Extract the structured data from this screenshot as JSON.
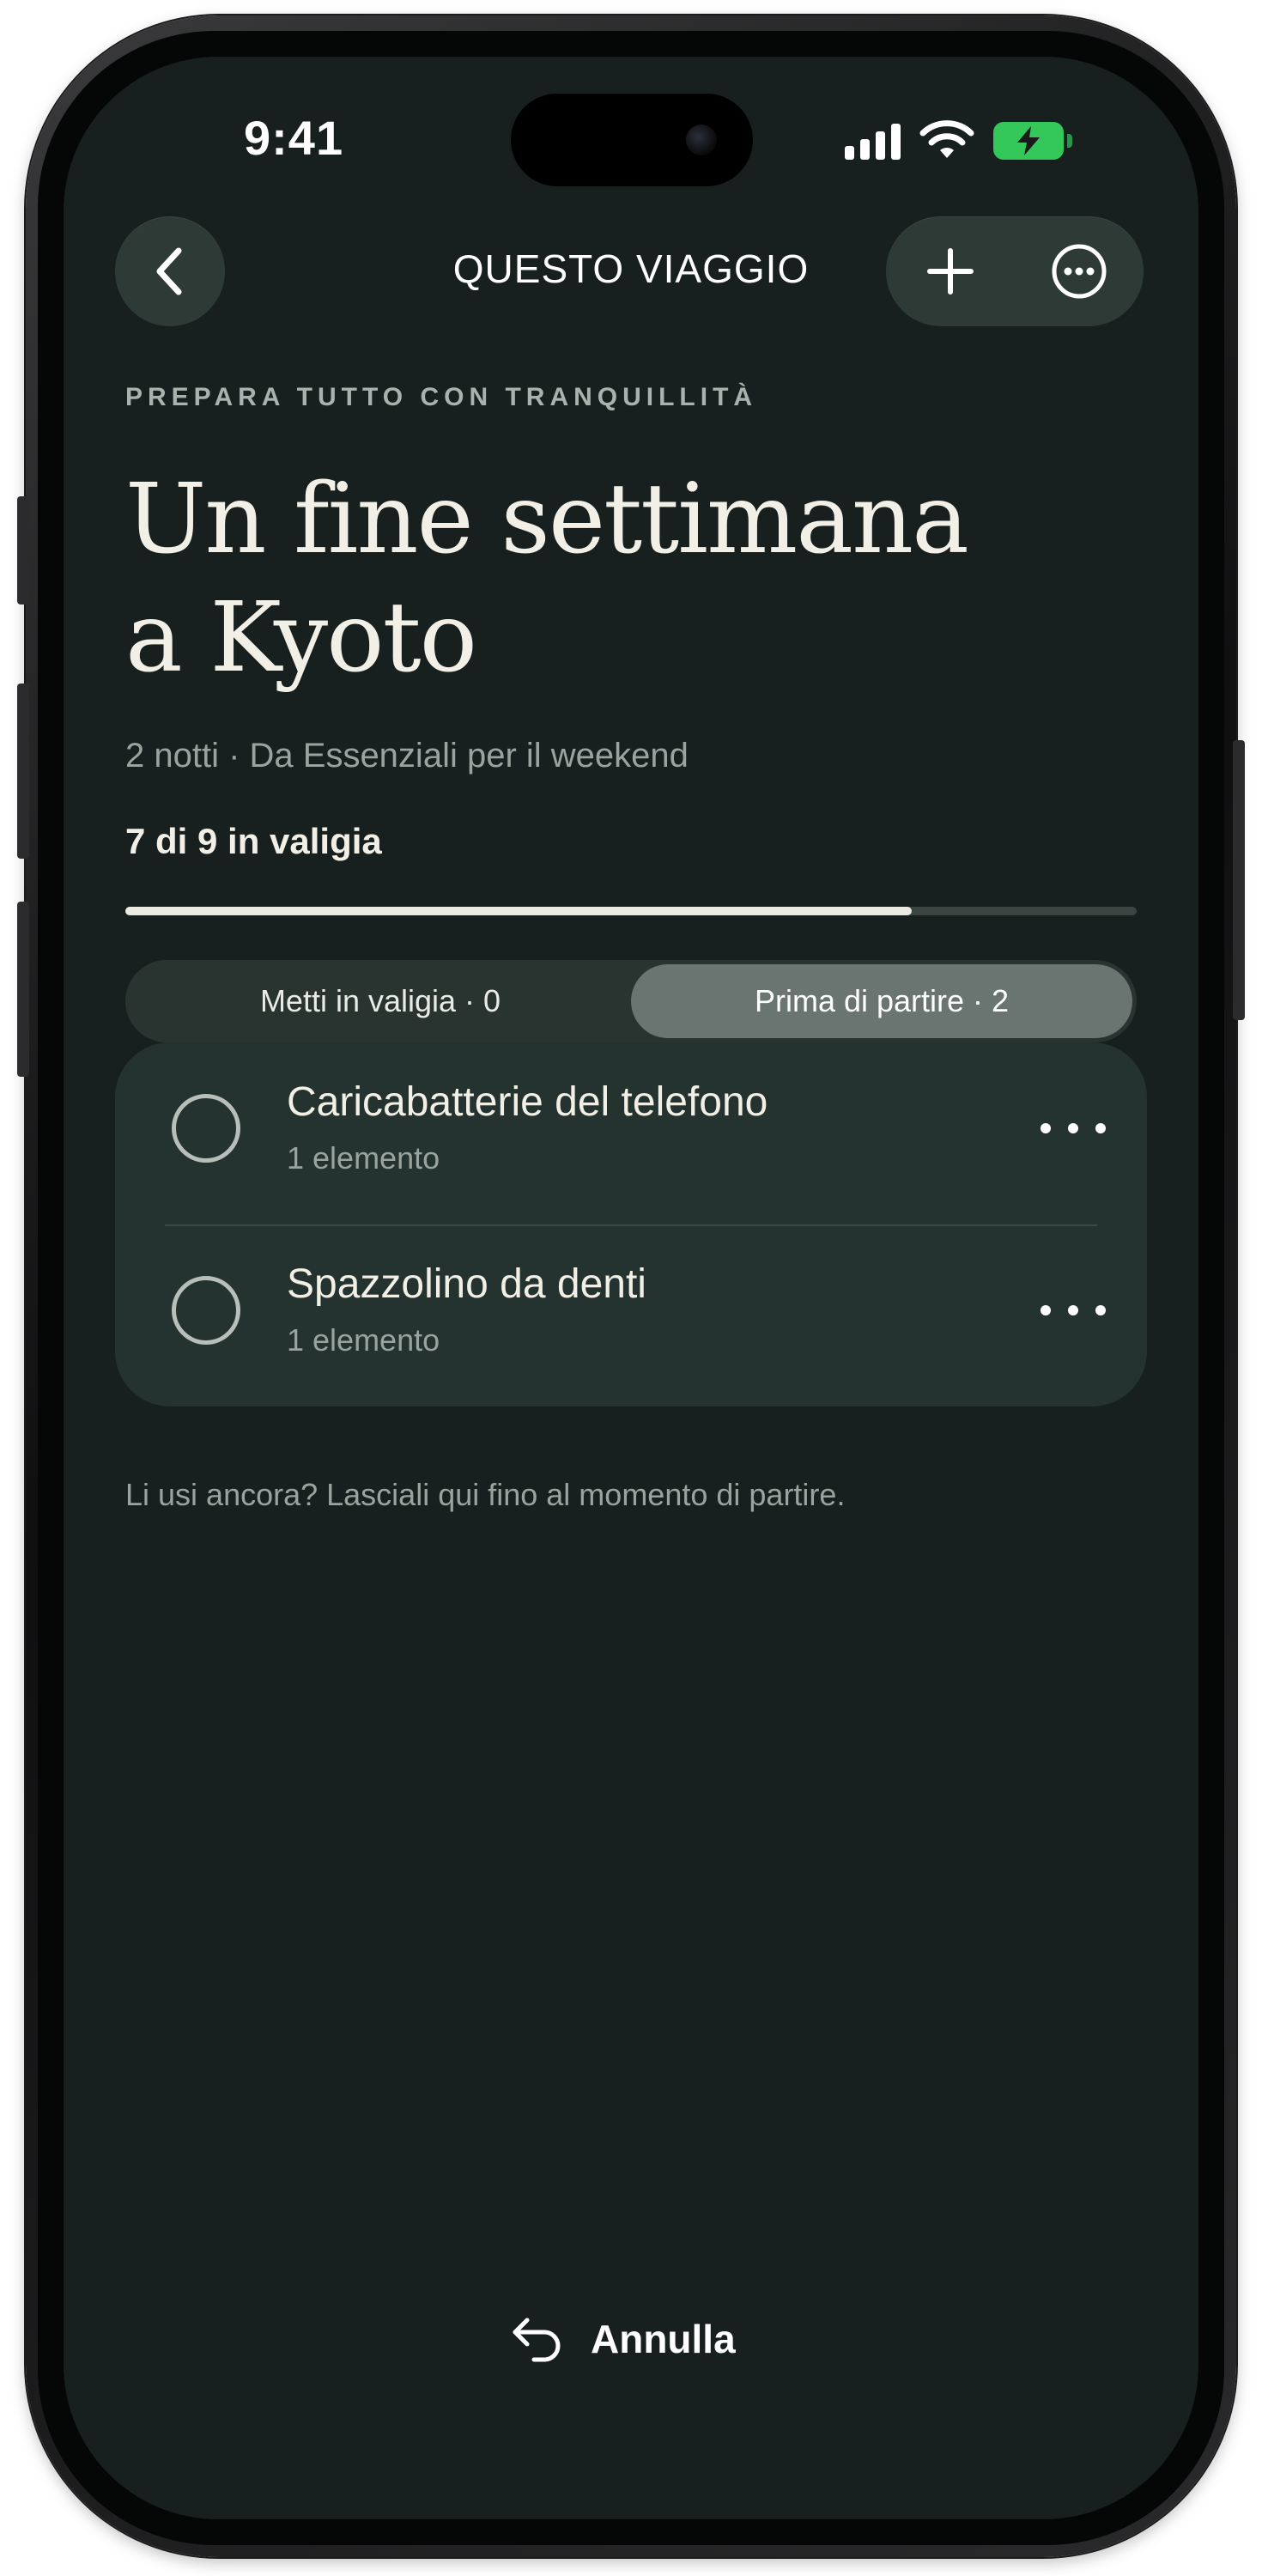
{
  "status_bar": {
    "time": "9:41"
  },
  "nav": {
    "title": "QUESTO VIAGGIO"
  },
  "header": {
    "eyebrow": "PREPARA TUTTO CON TRANQUILLITÀ",
    "title_line1": "Un fine settimana",
    "title_line2": "a Kyoto",
    "subtitle": "2 notti · Da Essenziali per il weekend"
  },
  "progress": {
    "label": "7 di 9 in valigia",
    "packed": 7,
    "total": 9
  },
  "segments": [
    {
      "label": "Metti in valigia · 0",
      "active": false
    },
    {
      "label": "Prima di partire · 2",
      "active": true
    }
  ],
  "items": [
    {
      "name": "Caricabatterie del telefono",
      "meta": "1 elemento"
    },
    {
      "name": "Spazzolino da denti",
      "meta": "1 elemento"
    }
  ],
  "footnote": "Li usi ancora? Lasciali qui fino al momento di partire.",
  "undo": {
    "label": "Annulla"
  },
  "colors": {
    "background": "#17201e",
    "card": "#243330",
    "accent_battery": "#34c759",
    "text_primary": "#f1efe6",
    "text_secondary": "#9aa39e"
  },
  "icons": {
    "back": "chevron-left-icon",
    "add": "plus-icon",
    "more": "ellipsis-circle-icon",
    "row_more": "ellipsis-icon",
    "undo": "undo-arrow-icon"
  }
}
